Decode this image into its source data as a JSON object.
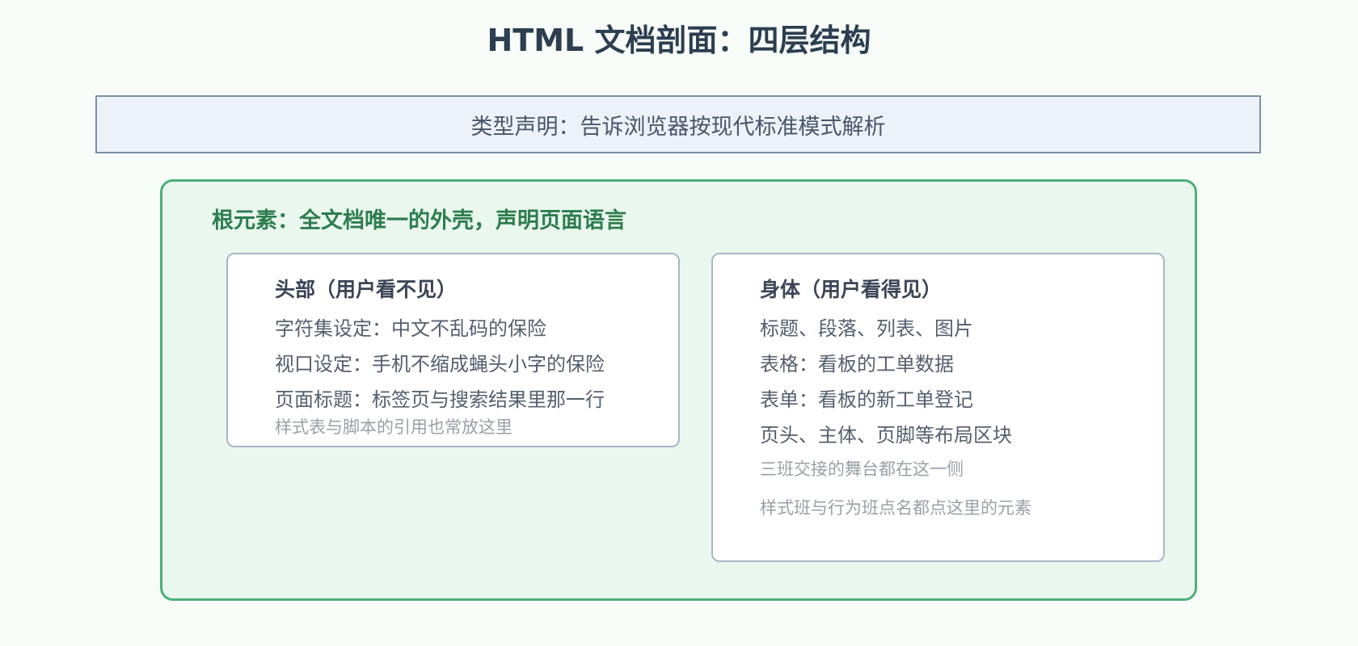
{
  "title": "HTML 文档剖面：四层结构",
  "doctype": {
    "label": "类型声明：告诉浏览器按现代标准模式解析"
  },
  "root": {
    "label": "根元素：全文档唯一的外壳，声明页面语言"
  },
  "head": {
    "title": "头部（用户看不见）",
    "items": [
      "字符集设定：中文不乱码的保险",
      "视口设定：手机不缩成蝇头小字的保险",
      "页面标题：标签页与搜索结果里那一行"
    ],
    "notes": [
      "样式表与脚本的引用也常放这里"
    ]
  },
  "body": {
    "title": "身体（用户看得见）",
    "items": [
      "标题、段落、列表、图片",
      "表格：看板的工单数据",
      "表单：看板的新工单登记",
      "页头、主体、页脚等布局区块"
    ],
    "notes": [
      "三班交接的舞台都在这一侧",
      "样式班与行为班点名都点这里的元素"
    ]
  },
  "colors": {
    "root_border": "#4caf78",
    "root_fill": "#e9f7ee",
    "root_text": "#2e7d4f",
    "doctype_fill": "#edf2f8",
    "doctype_border": "#7f8fa6"
  }
}
